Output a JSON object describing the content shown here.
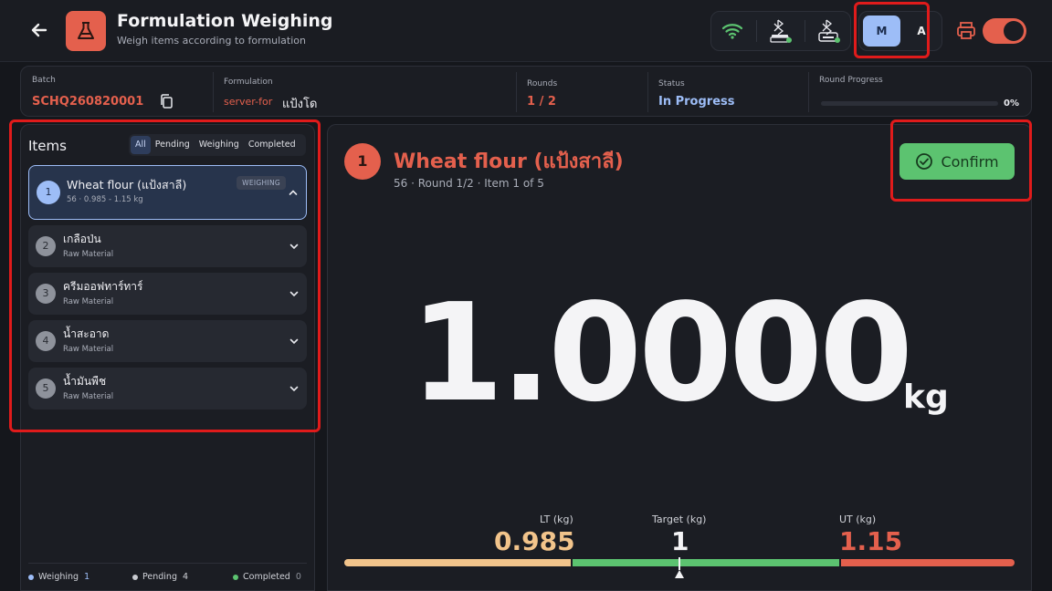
{
  "header": {
    "back_icon": "arrow-left-icon",
    "logo_icon": "flask-icon",
    "title": "Formulation Weighing",
    "subtitle": "Weigh items according to formulation",
    "connections": [
      "wifi-icon",
      "bluetooth-scale-icon",
      "bluetooth-printer-icon"
    ],
    "mode": {
      "manual": "M",
      "auto": "A",
      "selected": "M"
    },
    "print_toggle": true
  },
  "info": {
    "batch_label": "Batch",
    "batch_value": "SCHQ260820001",
    "formulation_label": "Formulation",
    "formulation_code": "server-for",
    "formulation_name": "แป้งโด",
    "rounds_label": "Rounds",
    "rounds_value": "1 / 2",
    "status_label": "Status",
    "status_value": "In Progress",
    "progress_label": "Round Progress",
    "progress_value": "0%",
    "progress_fraction": 0
  },
  "items_panel": {
    "title": "Items",
    "filters": [
      "All",
      "Pending",
      "Weighing",
      "Completed"
    ],
    "active_filter": "All",
    "items": [
      {
        "num": "1",
        "name": "Wheat flour (แป้งสาลี)",
        "sub": "56 · 0.985 - 1.15 kg",
        "badge": "WEIGHING"
      },
      {
        "num": "2",
        "name": "เกลือป่น",
        "sub": "Raw Material"
      },
      {
        "num": "3",
        "name": "ครีมออฟทาร์ทาร์",
        "sub": "Raw Material"
      },
      {
        "num": "4",
        "name": "น้ำสะอาด",
        "sub": "Raw Material"
      },
      {
        "num": "5",
        "name": "น้ำมันพืช",
        "sub": "Raw Material"
      }
    ],
    "legend": [
      {
        "label": "Weighing",
        "count": "1",
        "color": "#9dbdf7"
      },
      {
        "label": "Pending",
        "count": "4",
        "color": "#c8cad0"
      },
      {
        "label": "Completed",
        "count": "0",
        "color": "#5cc370"
      }
    ]
  },
  "main": {
    "item_num": "1",
    "item_title": "Wheat flour (แป้งสาลี)",
    "item_sub": "56 · Round 1/2 · Item 1 of 5",
    "confirm_label": "Confirm",
    "reading": "1.0000",
    "unit": "kg",
    "lt_label": "LT (kg)",
    "lt_value": "0.985",
    "target_label": "Target (kg)",
    "target_value": "1",
    "ut_label": "UT (kg)",
    "ut_value": "1.15"
  },
  "colors": {
    "accent": "#e4604d",
    "primary": "#9dbdf7",
    "success": "#5cc370",
    "lower": "#f2c48b",
    "upper": "#e4604d"
  }
}
